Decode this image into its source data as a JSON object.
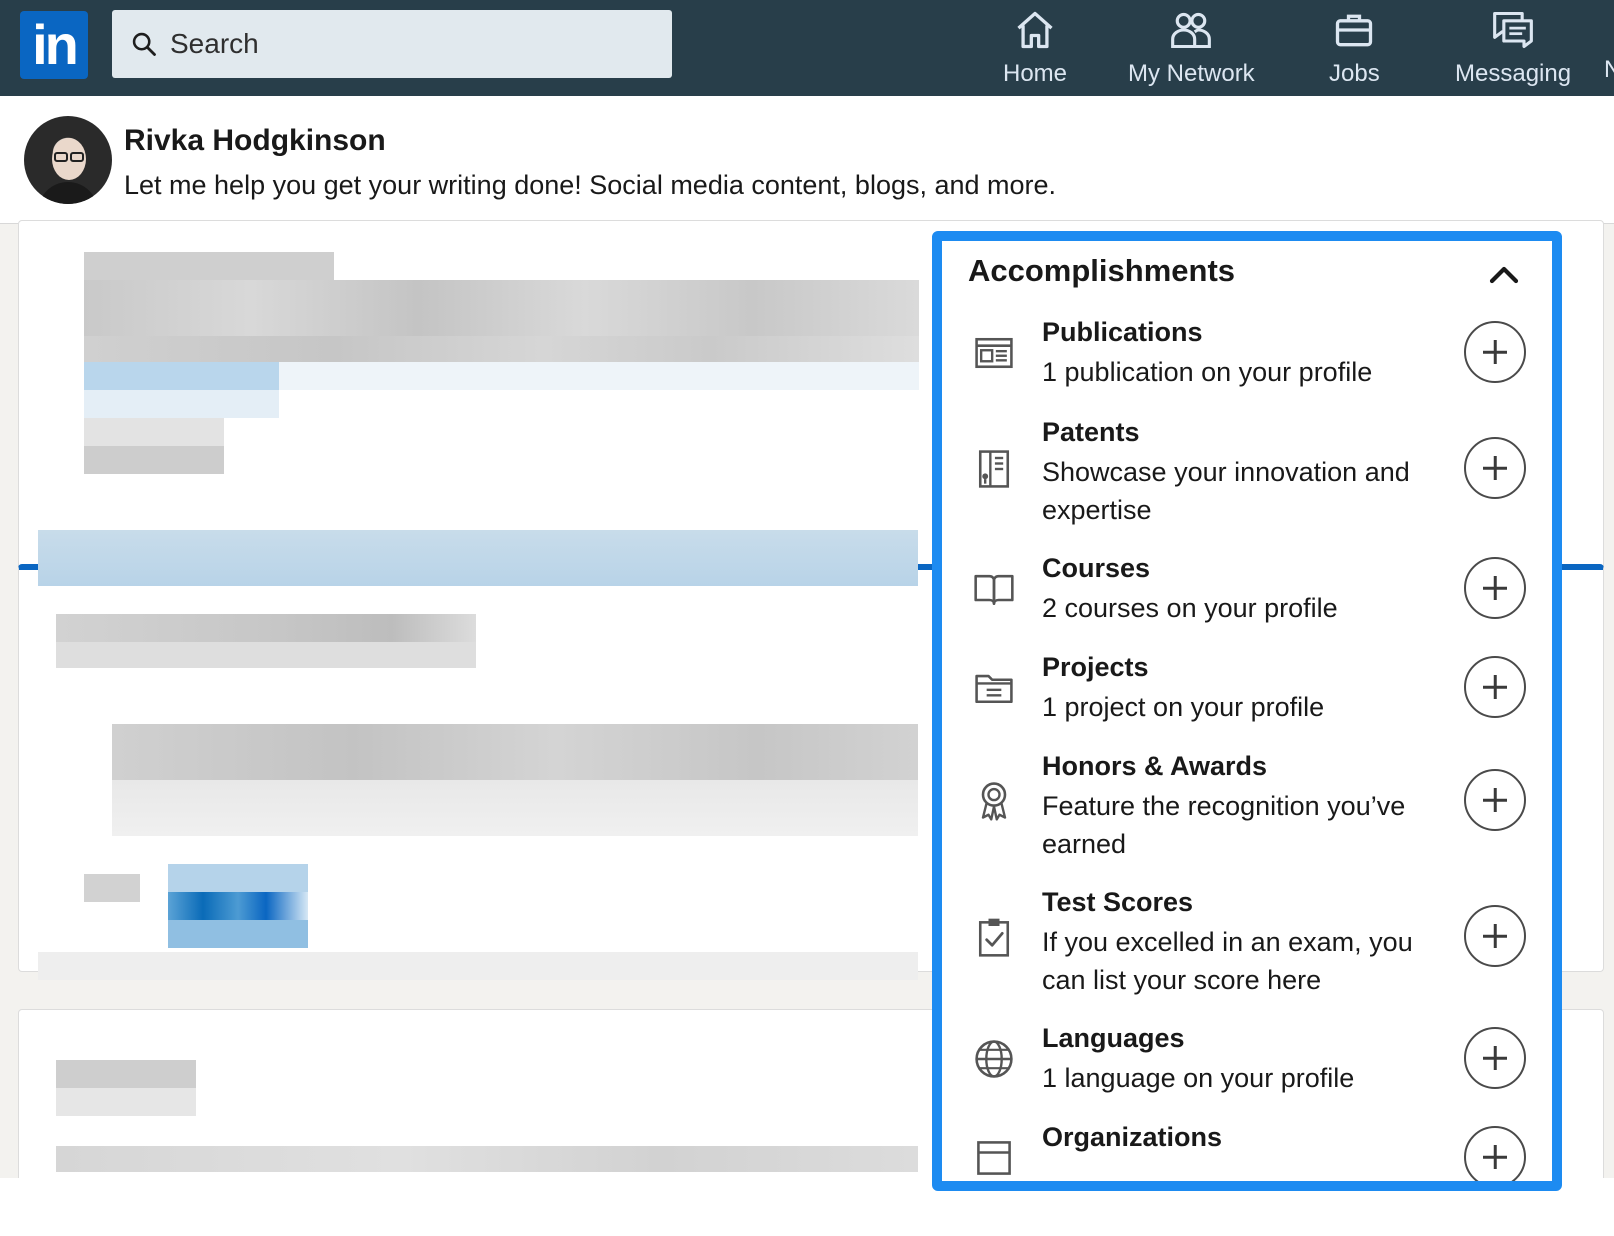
{
  "header": {
    "logo_text": "in",
    "search_placeholder": "Search",
    "nav": [
      {
        "label": "Home",
        "icon": "home-icon"
      },
      {
        "label": "My Network",
        "icon": "network-icon"
      },
      {
        "label": "Jobs",
        "icon": "briefcase-icon"
      },
      {
        "label": "Messaging",
        "icon": "messaging-icon"
      }
    ],
    "nav_clipped": "N"
  },
  "profile": {
    "name": "Rivka Hodgkinson",
    "headline": "Let me help you get your writing done! Social media content, blogs, and more."
  },
  "accomplishments": {
    "title": "Accomplishments",
    "items": [
      {
        "title": "Publications",
        "subtitle": "1 publication on your profile",
        "icon": "publication-icon"
      },
      {
        "title": "Patents",
        "subtitle": "Showcase your innovation and expertise",
        "icon": "patent-icon"
      },
      {
        "title": "Courses",
        "subtitle": "2 courses on your profile",
        "icon": "book-icon"
      },
      {
        "title": "Projects",
        "subtitle": "1 project on your profile",
        "icon": "folder-icon"
      },
      {
        "title": "Honors & Awards",
        "subtitle": "Feature the recognition you’ve earned",
        "icon": "award-icon"
      },
      {
        "title": "Test Scores",
        "subtitle": "If you excelled in an exam, you can list your score here",
        "icon": "clipboard-check-icon"
      },
      {
        "title": "Languages",
        "subtitle": "1 language on your profile",
        "icon": "globe-icon"
      },
      {
        "title": "Organizations",
        "subtitle": "",
        "icon": "organization-icon"
      }
    ]
  },
  "colors": {
    "nav_bg": "#283e4a",
    "brand_blue": "#0a66c2",
    "highlight_border": "#1d8bf1"
  }
}
